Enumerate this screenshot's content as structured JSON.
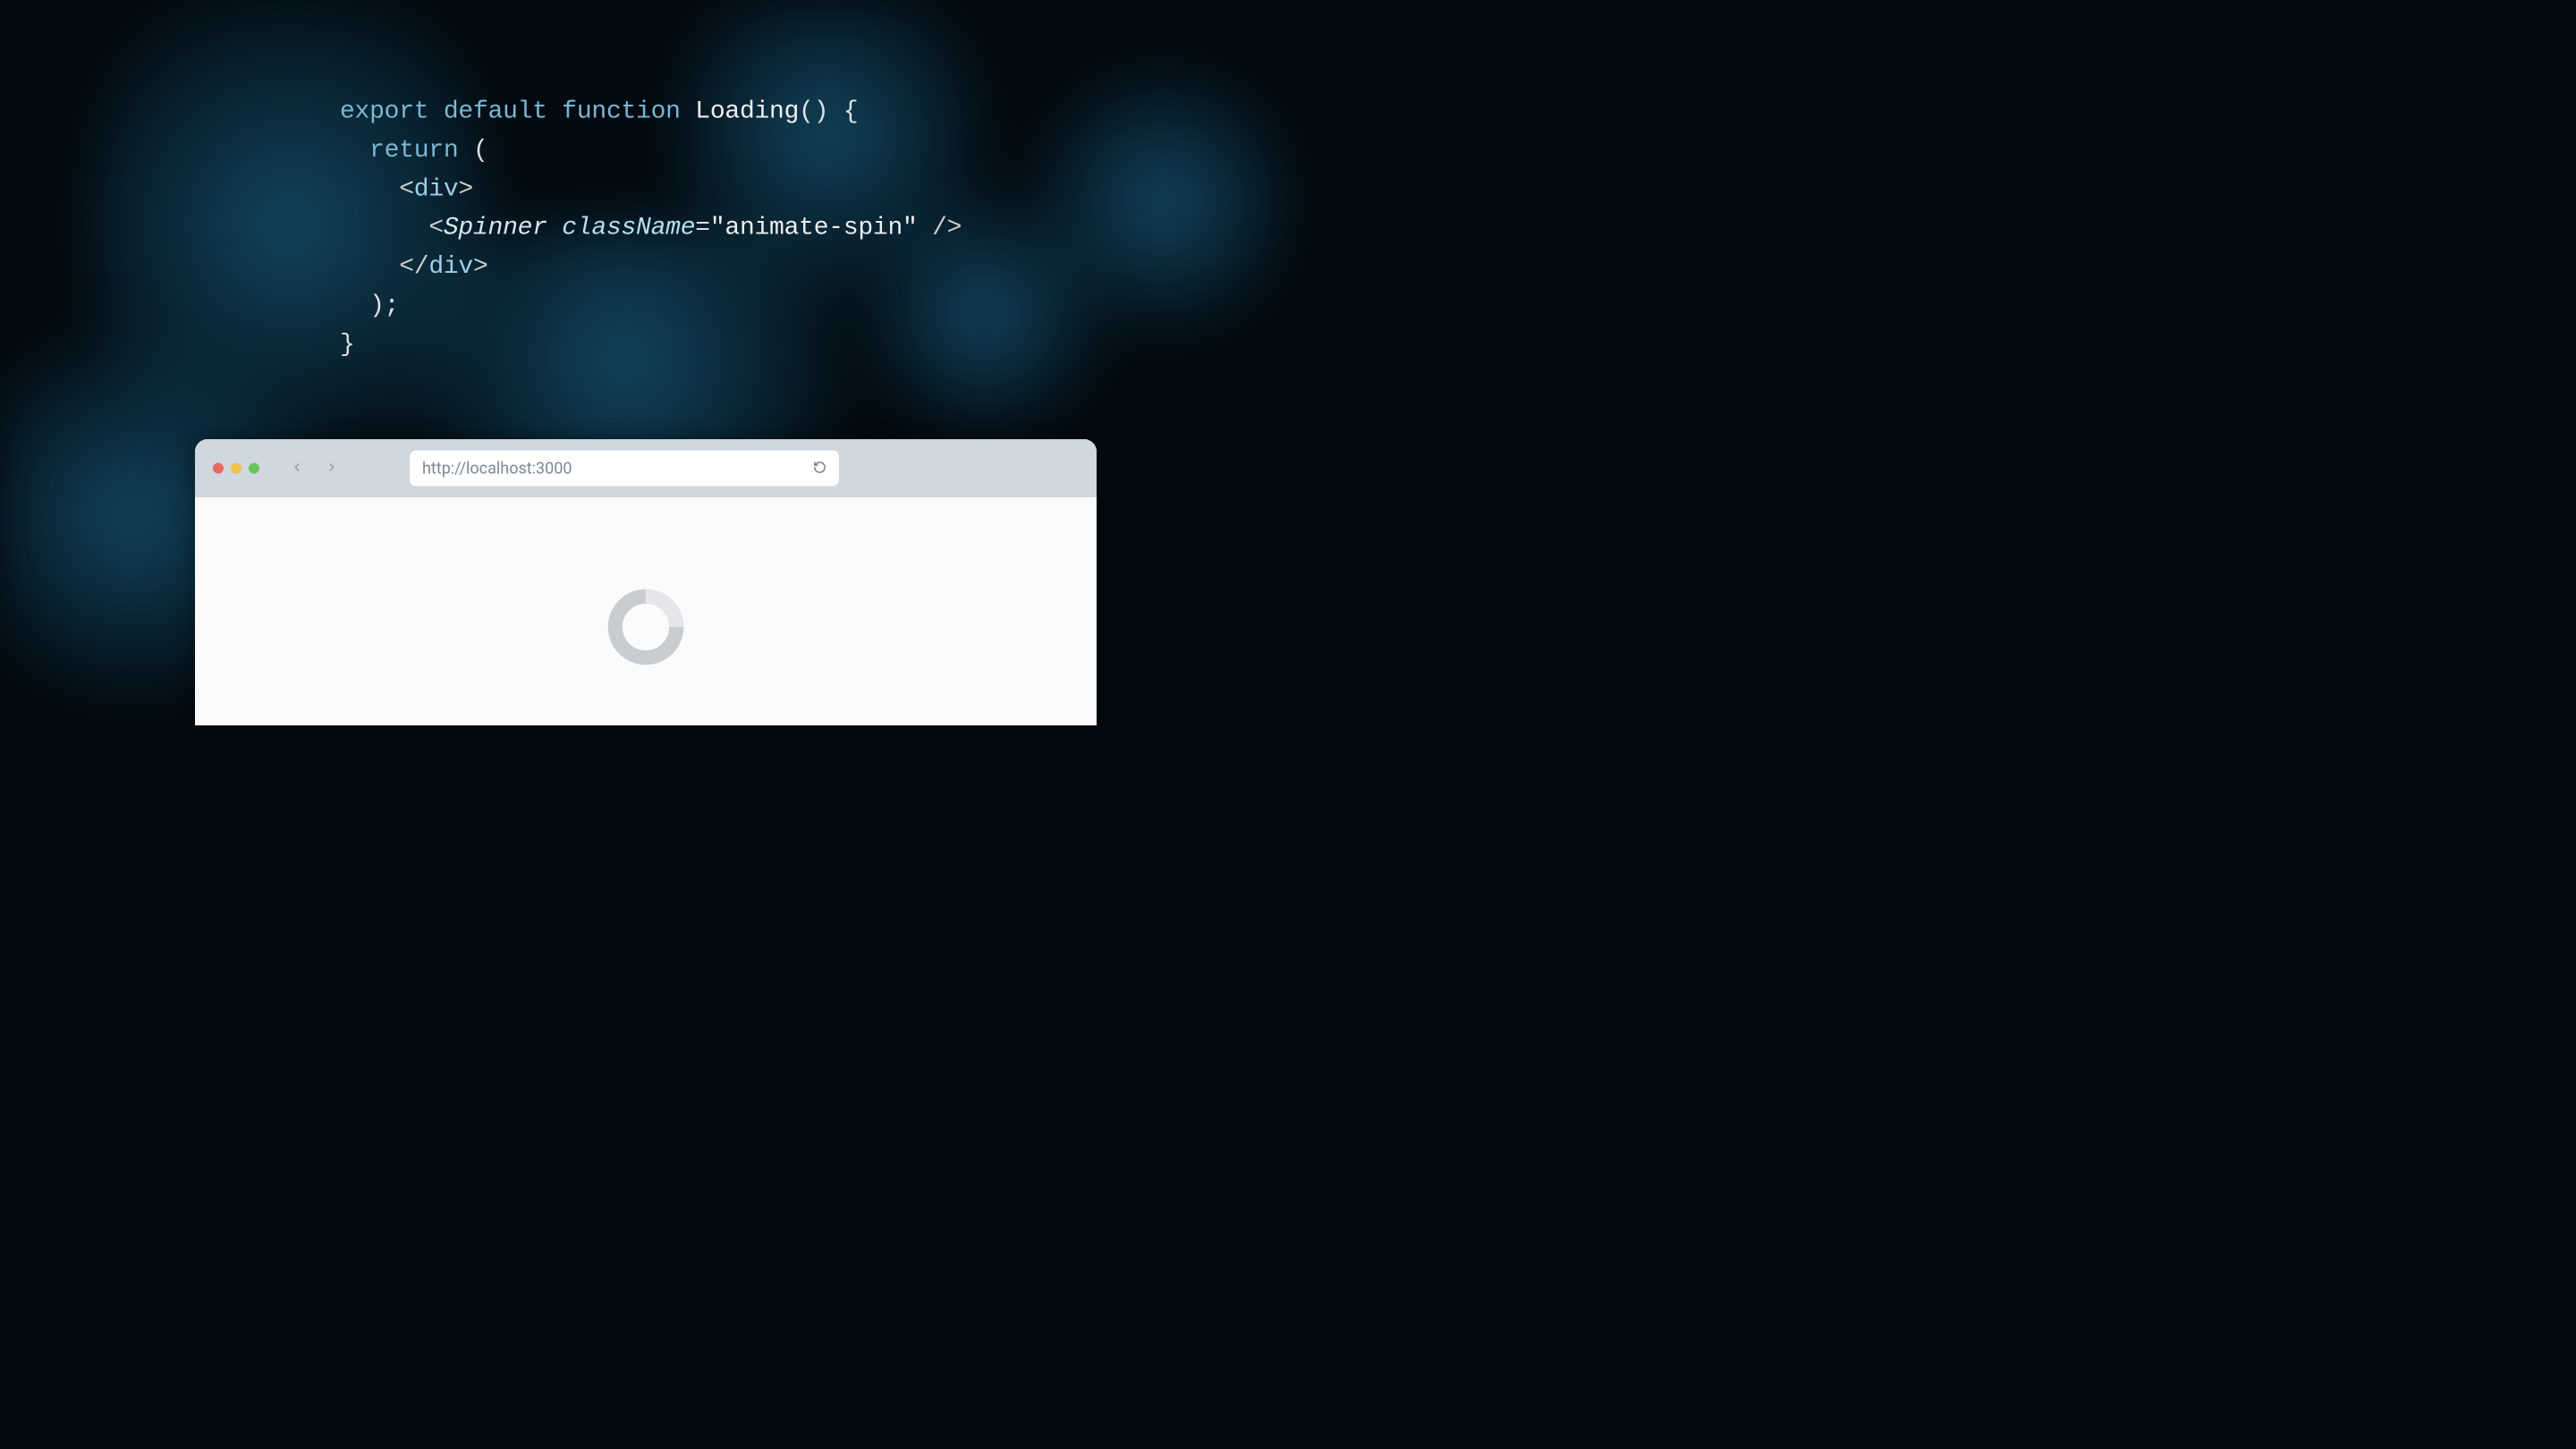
{
  "code": {
    "line1": {
      "kw_export": "export",
      "kw_default": "default",
      "kw_function": "function",
      "fn_name": "Loading",
      "parens": "()",
      "brace_open": " {"
    },
    "line2": {
      "kw_return": "return",
      "paren": " ("
    },
    "line3": {
      "open": "<",
      "tag": "div",
      "close": ">"
    },
    "line4": {
      "open": "<",
      "comp": "Spinner",
      "attr": "className",
      "eq": "=",
      "quote1": "\"",
      "str": "animate-spin",
      "quote2": "\"",
      "selfclose": " />"
    },
    "line5": {
      "open": "</",
      "tag": "div",
      "close": ">"
    },
    "line6": {
      "text": ");"
    },
    "line7": {
      "text": "}"
    }
  },
  "browser": {
    "url": "http://localhost:3000"
  },
  "colors": {
    "traffic_red": "#e8695d",
    "traffic_yellow": "#f0c04b",
    "traffic_green": "#6ac55a"
  }
}
